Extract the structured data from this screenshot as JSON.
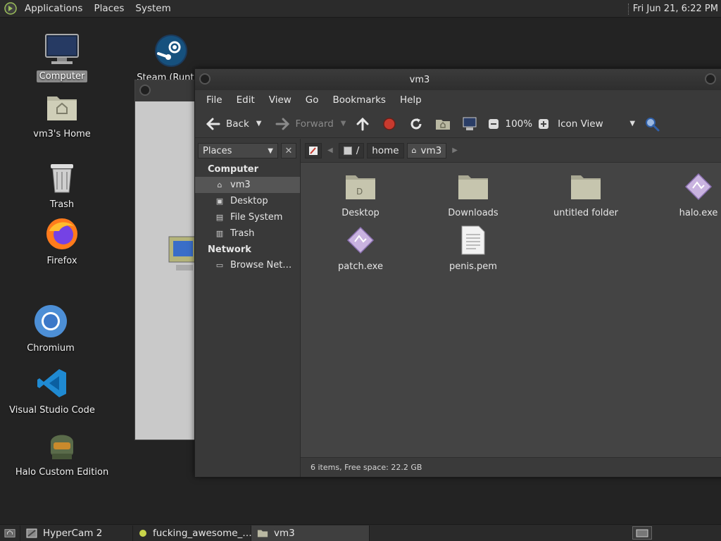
{
  "top_panel": {
    "menus": [
      "Applications",
      "Places",
      "System"
    ],
    "clock": "Fri Jun 21,  6:22 PM"
  },
  "desktop": {
    "icons": [
      {
        "label": "Computer",
        "icon": "computer-icon",
        "selected": true
      },
      {
        "label": "Steam (Runtim",
        "icon": "steam-icon"
      },
      {
        "label": "vm3's Home",
        "icon": "home-folder-icon"
      },
      {
        "label": "Trash",
        "icon": "trash-icon"
      },
      {
        "label": "Firefox",
        "icon": "firefox-icon"
      },
      {
        "label": "Chromium",
        "icon": "chromium-icon"
      },
      {
        "label": "Visual Studio Code",
        "icon": "vscode-icon"
      },
      {
        "label": "Halo Custom Edition",
        "icon": "halo-icon"
      }
    ]
  },
  "file_manager": {
    "title": "vm3",
    "menu": [
      "File",
      "Edit",
      "View",
      "Go",
      "Bookmarks",
      "Help"
    ],
    "toolbar": {
      "back": "Back",
      "forward": "Forward",
      "zoom": "100%",
      "view_mode": "Icon View"
    },
    "sidebar": {
      "selector": "Places",
      "sections": [
        {
          "title": "Computer",
          "items": [
            {
              "label": "vm3",
              "icon": "home-icon",
              "selected": true
            },
            {
              "label": "Desktop",
              "icon": "desktop-icon"
            },
            {
              "label": "File System",
              "icon": "drive-icon"
            },
            {
              "label": "Trash",
              "icon": "trash-icon"
            }
          ]
        },
        {
          "title": "Network",
          "items": [
            {
              "label": "Browse Net…",
              "icon": "network-icon"
            }
          ]
        }
      ]
    },
    "pathbar": {
      "separator": "/",
      "segments": [
        "home",
        "vm3"
      ]
    },
    "files": [
      {
        "name": "Desktop",
        "icon": "folder-desktop-icon"
      },
      {
        "name": "Downloads",
        "icon": "folder-icon"
      },
      {
        "name": "untitled folder",
        "icon": "folder-icon"
      },
      {
        "name": "halo.exe",
        "icon": "wine-exe-icon"
      },
      {
        "name": "patch.exe",
        "icon": "wine-exe-icon"
      },
      {
        "name": "penis.pem",
        "icon": "text-file-icon"
      }
    ],
    "status": "6 items, Free space: 22.2 GB"
  },
  "taskbar": {
    "tasks": [
      {
        "label": "HyperCam 2",
        "icon": "hypercam-icon"
      },
      {
        "label": "fucking_awesome_…",
        "icon": "bulb-icon"
      },
      {
        "label": "vm3",
        "icon": "folder-home-icon",
        "active": true
      }
    ]
  }
}
